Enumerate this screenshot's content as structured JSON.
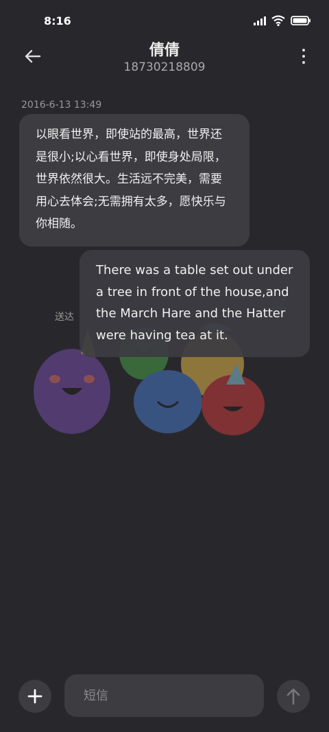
{
  "status_bar": {
    "time": "8:16"
  },
  "header": {
    "back_icon": "arrow-left-icon",
    "contact_name": "倩倩",
    "phone_number": "18730218809",
    "more_icon": "more-vertical-icon"
  },
  "conversation": {
    "timestamp": "2016-6-13 13:49",
    "incoming_message": "以眼看世界，即使站的最高，世界还是很小;以心看世界，即使身处局限，世界依然很大。生活远不完美，需要用心去体会;无需拥有太多，愿快乐与你相随。",
    "outgoing_message": "There was a table set out under a tree in front of the house,and the March Hare and the Hatter were having tea at it.",
    "status_label": "送达"
  },
  "composer": {
    "add_icon": "plus-icon",
    "placeholder": "短信",
    "send_icon": "arrow-up-icon"
  },
  "colors": {
    "background": "#28282c",
    "bubble": "#3c3c41",
    "secondary_text": "#999999"
  }
}
